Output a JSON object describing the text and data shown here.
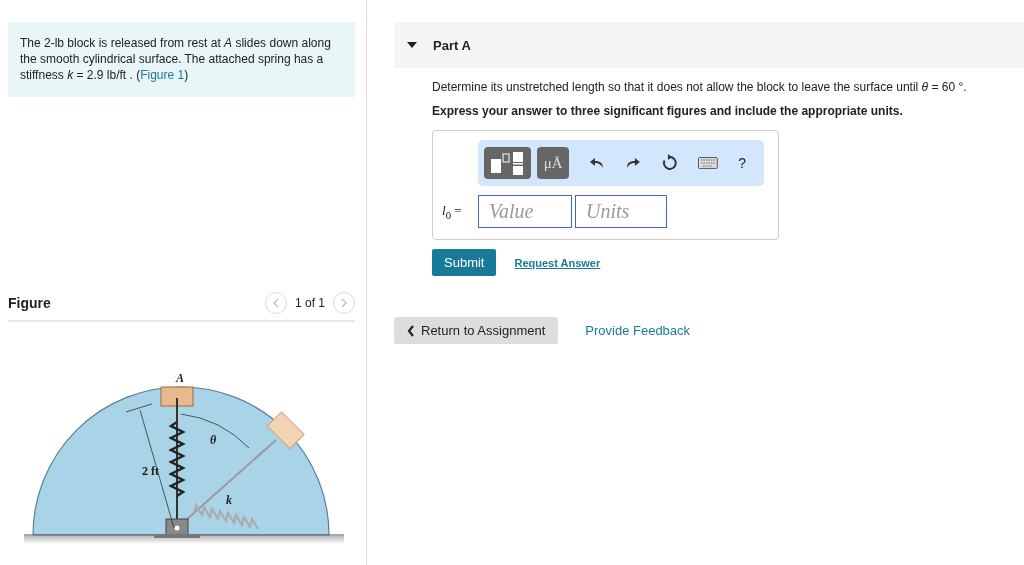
{
  "problem": {
    "text": "The 2-lb block is released from rest at *A* slides down along the smooth cylindrical surface. The attached spring has a stiffness *k* = 2.9  lb/ft . (",
    "figure_link": "Figure 1",
    "text_after": ")"
  },
  "figure": {
    "title": "Figure",
    "pager": "1 of 1",
    "prev_disabled": true,
    "next_disabled": true,
    "labels": {
      "block": "A",
      "angle": "θ",
      "radius": "2 ft",
      "spring": "k"
    }
  },
  "part": {
    "title": "Part A",
    "expanded": true,
    "question": "Determine its unstretched length so that it does not allow the block to leave the surface until *θ* = 60 °.",
    "instruction": "Express your answer to three significant figures and include the appropriate units.",
    "toolbar": {
      "symbols": "μÅ",
      "help": "?"
    },
    "answer": {
      "label": "*l*$_{0}$ =",
      "value_placeholder": "Value",
      "units_placeholder": "Units"
    },
    "submit": "Submit",
    "request": "Request Answer"
  },
  "footer": {
    "return": "Return to Assignment",
    "feedback": "Provide Feedback"
  }
}
